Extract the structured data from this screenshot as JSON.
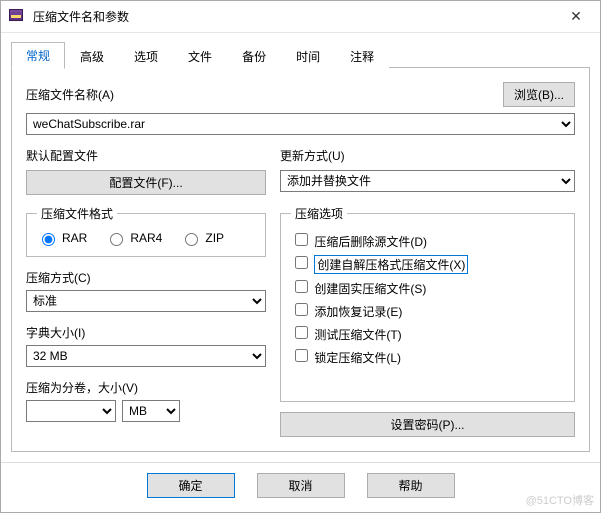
{
  "window": {
    "title": "压缩文件名和参数"
  },
  "tabs": {
    "items": [
      "常规",
      "高级",
      "选项",
      "文件",
      "备份",
      "时间",
      "注释"
    ],
    "active": 0
  },
  "archive": {
    "name_label": "压缩文件名称(A)",
    "browse_btn": "浏览(B)...",
    "name_value": "weChatSubscribe.rar"
  },
  "profile": {
    "label": "默认配置文件",
    "btn": "配置文件(F)..."
  },
  "update": {
    "label": "更新方式(U)",
    "value": "添加并替换文件"
  },
  "format": {
    "legend": "压缩文件格式",
    "options": [
      "RAR",
      "RAR4",
      "ZIP"
    ],
    "selected": 0
  },
  "method": {
    "label": "压缩方式(C)",
    "value": "标准"
  },
  "dictionary": {
    "label": "字典大小(I)",
    "value": "32 MB"
  },
  "volume": {
    "label": "压缩为分卷，大小(V)",
    "value": "",
    "unit": "MB"
  },
  "options": {
    "legend": "压缩选项",
    "items": [
      {
        "label": "压缩后删除源文件(D)",
        "highlight": false
      },
      {
        "label": "创建自解压格式压缩文件(X)",
        "highlight": true
      },
      {
        "label": "创建固实压缩文件(S)",
        "highlight": false
      },
      {
        "label": "添加恢复记录(E)",
        "highlight": false
      },
      {
        "label": "测试压缩文件(T)",
        "highlight": false
      },
      {
        "label": "锁定压缩文件(L)",
        "highlight": false
      }
    ],
    "password_btn": "设置密码(P)..."
  },
  "buttons": {
    "ok": "确定",
    "cancel": "取消",
    "help": "帮助"
  },
  "watermark": "@51CTO博客"
}
